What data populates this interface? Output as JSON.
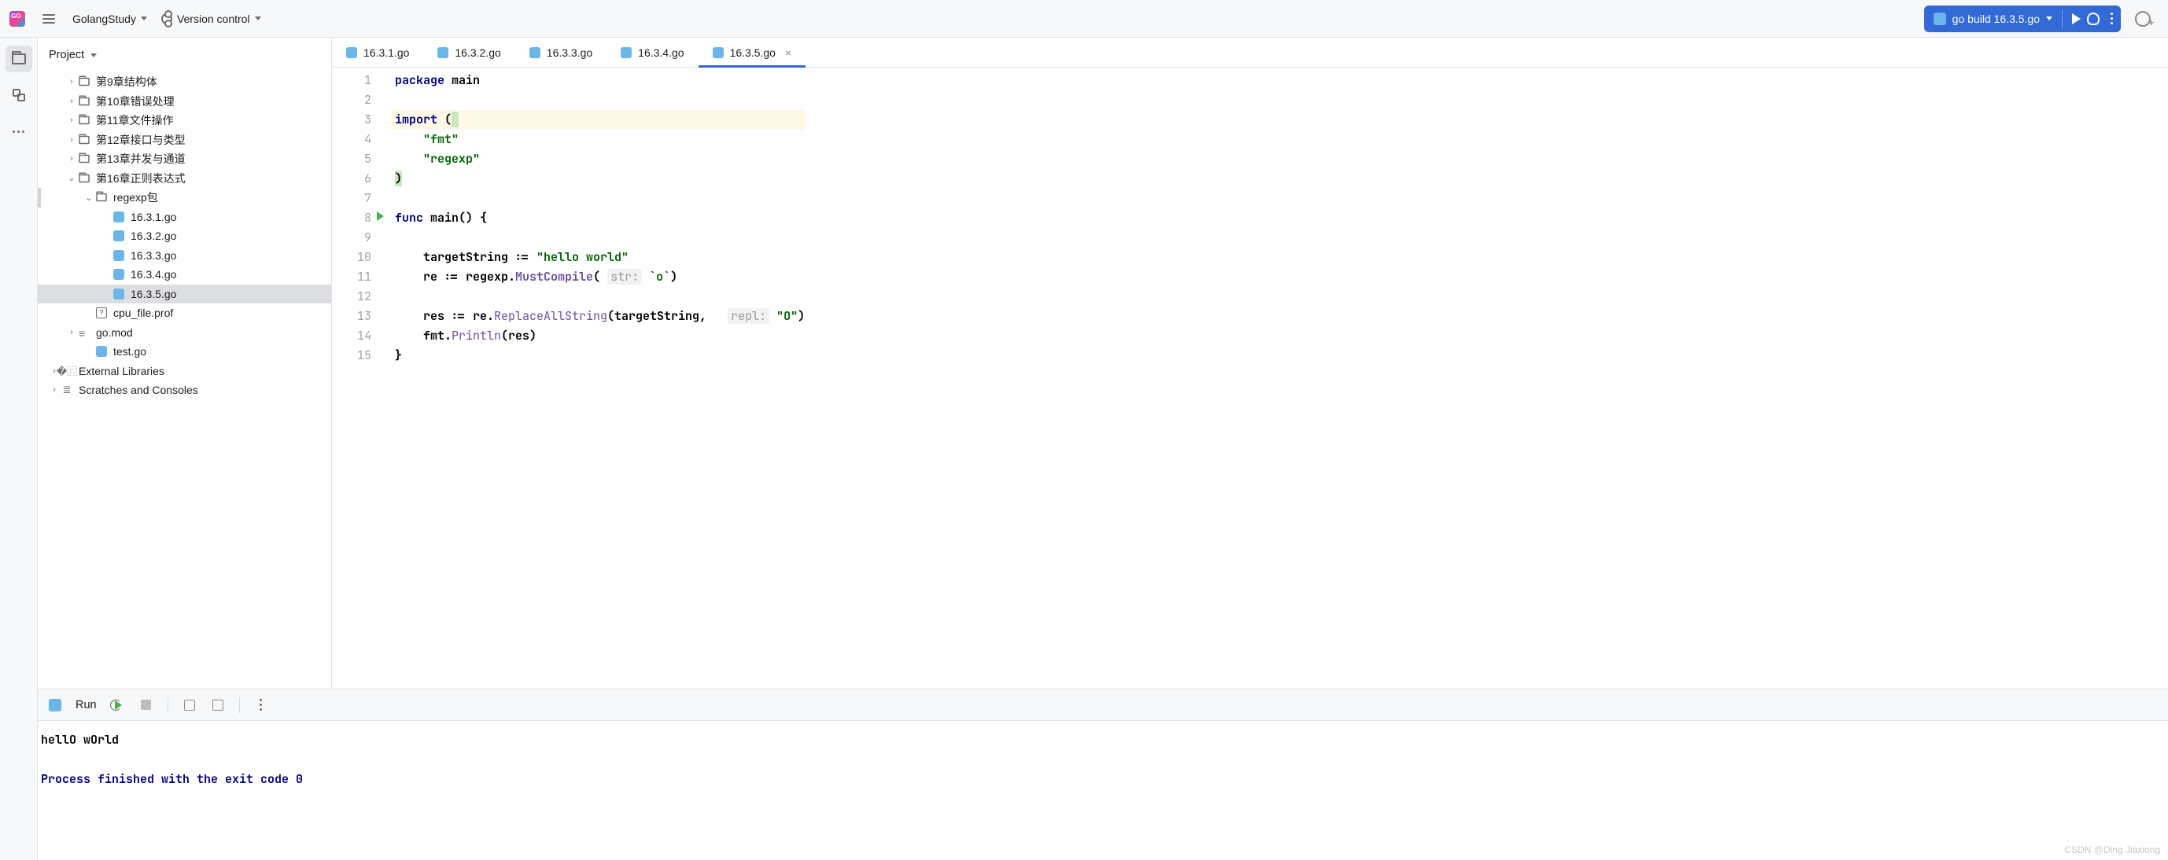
{
  "topbar": {
    "project_name": "GolangStudy",
    "vcs_label": "Version control",
    "run_config_label": "go build 16.3.5.go"
  },
  "sidebar": {
    "title": "Project",
    "tree": [
      {
        "indent": 1,
        "exp": "›",
        "icon": "folder",
        "label": "第9章结构体"
      },
      {
        "indent": 1,
        "exp": "›",
        "icon": "folder",
        "label": "第10章错误处理"
      },
      {
        "indent": 1,
        "exp": "›",
        "icon": "folder",
        "label": "第11章文件操作"
      },
      {
        "indent": 1,
        "exp": "›",
        "icon": "folder",
        "label": "第12章接口与类型"
      },
      {
        "indent": 1,
        "exp": "›",
        "icon": "folder",
        "label": "第13章并发与通道"
      },
      {
        "indent": 1,
        "exp": "⌄",
        "icon": "folder",
        "label": "第16章正则表达式"
      },
      {
        "indent": 2,
        "exp": "⌄",
        "icon": "folder",
        "label": "regexp包",
        "marked": true
      },
      {
        "indent": 3,
        "exp": "",
        "icon": "go",
        "label": "16.3.1.go"
      },
      {
        "indent": 3,
        "exp": "",
        "icon": "go",
        "label": "16.3.2.go"
      },
      {
        "indent": 3,
        "exp": "",
        "icon": "go",
        "label": "16.3.3.go"
      },
      {
        "indent": 3,
        "exp": "",
        "icon": "go",
        "label": "16.3.4.go"
      },
      {
        "indent": 3,
        "exp": "",
        "icon": "go",
        "label": "16.3.5.go",
        "selected": true
      },
      {
        "indent": 2,
        "exp": "",
        "icon": "txt",
        "label": "cpu_file.prof"
      },
      {
        "indent": 1,
        "exp": "›",
        "icon": "mod",
        "label": "go.mod"
      },
      {
        "indent": 2,
        "exp": "",
        "icon": "go",
        "label": "test.go"
      },
      {
        "indent": 0,
        "exp": "›",
        "icon": "lib",
        "label": "External Libraries"
      },
      {
        "indent": 0,
        "exp": "›",
        "icon": "scratch",
        "label": "Scratches and Consoles"
      }
    ]
  },
  "tabs": [
    {
      "label": "16.3.1.go"
    },
    {
      "label": "16.3.2.go"
    },
    {
      "label": "16.3.3.go"
    },
    {
      "label": "16.3.4.go"
    },
    {
      "label": "16.3.5.go",
      "active": true,
      "closable": true
    }
  ],
  "code": {
    "lines": [
      {
        "n": 1,
        "html": "<span class='kw'>package</span> <span class='plain'>main</span>"
      },
      {
        "n": 2,
        "html": ""
      },
      {
        "n": 3,
        "hl": true,
        "html": "<span class='kw'>import</span> <span class='plain'>(</span><span class='paren-match'>&nbsp;</span>"
      },
      {
        "n": 4,
        "html": "    <span class='str'>\"fmt\"</span>"
      },
      {
        "n": 5,
        "html": "    <span class='str'>\"regexp\"</span>"
      },
      {
        "n": 6,
        "html": "<span class='paren-match plain'>)</span>"
      },
      {
        "n": 7,
        "html": ""
      },
      {
        "n": 8,
        "run": true,
        "html": "<span class='kw'>func</span> <span class='plain'>main() {</span>"
      },
      {
        "n": 9,
        "html": ""
      },
      {
        "n": 10,
        "html": "    <span class='plain'>targetString := </span><span class='str'>\"hello world\"</span>"
      },
      {
        "n": 11,
        "html": "    <span class='plain'>re := regexp.</span><span class='fncBold'>MustCompile</span><span class='plain'>(</span> <span class='hint'>str:</span> <span class='str'>`o`</span><span class='plain'>)</span>"
      },
      {
        "n": 12,
        "html": ""
      },
      {
        "n": 13,
        "html": "    <span class='plain'>res := re.</span><span class='fnc'>ReplaceAllString</span><span class='plain'>(targetString,</span>   <span class='hint'>repl:</span> <span class='str'>\"O\"</span><span class='plain'>)</span>"
      },
      {
        "n": 14,
        "html": "    <span class='plain'>fmt.</span><span class='fnc'>Println</span><span class='plain'>(res)</span>"
      },
      {
        "n": 15,
        "html": "<span class='plain'>}</span>"
      }
    ]
  },
  "run_panel": {
    "title": "Run",
    "output_line": "hellO wOrld",
    "exit_line": "Process finished with the exit code 0"
  },
  "watermark": "CSDN @Ding Jiaxiong"
}
